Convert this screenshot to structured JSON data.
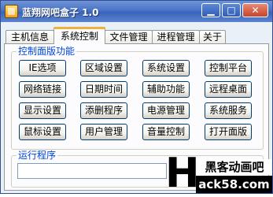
{
  "window": {
    "title": "蓝翔网吧盒子 1.0",
    "controls": {
      "minimize": "▁",
      "maximize": "□",
      "close": "✕"
    }
  },
  "tabs": [
    {
      "label": "主机信息"
    },
    {
      "label": "系统控制"
    },
    {
      "label": "文件管理"
    },
    {
      "label": "进程管理"
    },
    {
      "label": "关于"
    }
  ],
  "active_tab": "系统控制",
  "control_panel": {
    "label": "控制面版功能",
    "buttons": [
      "IE选项",
      "区域设置",
      "系统设置",
      "控制平台",
      "网络链接",
      "日期时间",
      "辅助功能",
      "远程桌面",
      "显示设置",
      "添删程序",
      "电源管理",
      "系统服务",
      "鼠标设置",
      "用户管理",
      "音量控制",
      "打开面版"
    ]
  },
  "run_program": {
    "label": "运行程序",
    "value": ""
  },
  "watermark": {
    "letter": "H",
    "top": "黑客动画吧",
    "bottom": "ack58.com"
  }
}
